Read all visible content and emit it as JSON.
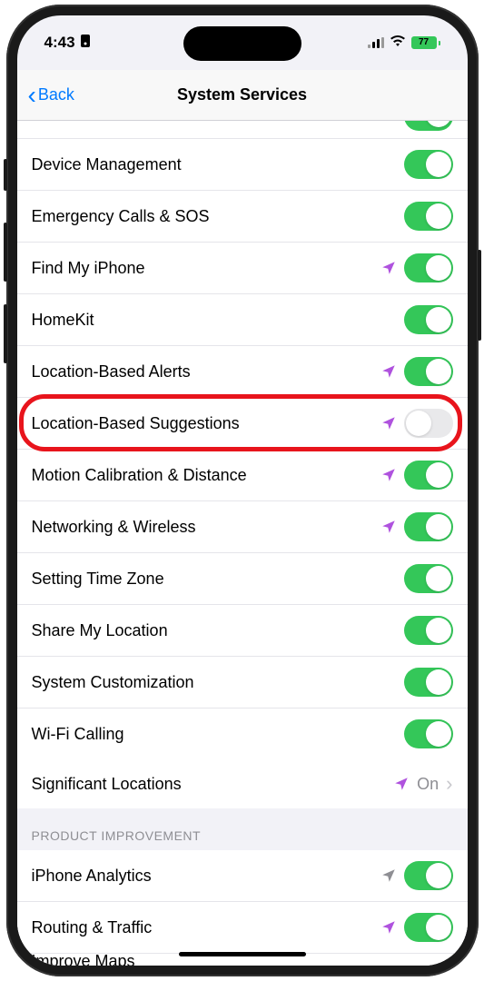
{
  "status": {
    "time": "4:43",
    "battery": "77"
  },
  "nav": {
    "back": "Back",
    "title": "System Services"
  },
  "items": [
    {
      "label": "Device Management",
      "toggle": "on",
      "arrow": "none"
    },
    {
      "label": "Emergency Calls & SOS",
      "toggle": "on",
      "arrow": "none"
    },
    {
      "label": "Find My iPhone",
      "toggle": "on",
      "arrow": "purple"
    },
    {
      "label": "HomeKit",
      "toggle": "on",
      "arrow": "none"
    },
    {
      "label": "Location-Based Alerts",
      "toggle": "on",
      "arrow": "purple"
    },
    {
      "label": "Location-Based Suggestions",
      "toggle": "off",
      "arrow": "purple",
      "highlighted": true
    },
    {
      "label": "Motion Calibration & Distance",
      "toggle": "on",
      "arrow": "purple"
    },
    {
      "label": "Networking & Wireless",
      "toggle": "on",
      "arrow": "purple"
    },
    {
      "label": "Setting Time Zone",
      "toggle": "on",
      "arrow": "none"
    },
    {
      "label": "Share My Location",
      "toggle": "on",
      "arrow": "none"
    },
    {
      "label": "System Customization",
      "toggle": "on",
      "arrow": "none"
    },
    {
      "label": "Wi-Fi Calling",
      "toggle": "on",
      "arrow": "none"
    }
  ],
  "drill": {
    "label": "Significant Locations",
    "value": "On",
    "arrow": "purple"
  },
  "section2": {
    "header": "Product Improvement",
    "items": [
      {
        "label": "iPhone Analytics",
        "toggle": "on",
        "arrow": "gray"
      },
      {
        "label": "Routing & Traffic",
        "toggle": "on",
        "arrow": "purple"
      }
    ],
    "cutoff": "Improve Maps"
  }
}
